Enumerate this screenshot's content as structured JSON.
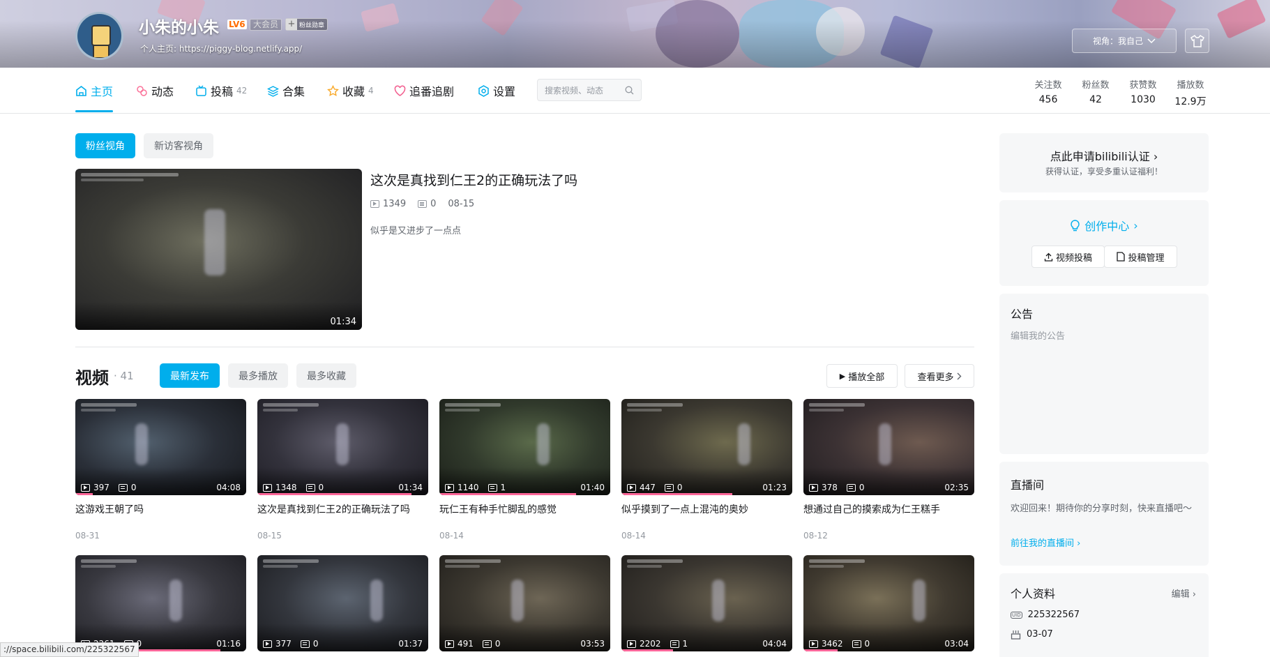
{
  "header": {
    "username": "小朱的小朱",
    "level": "LV6",
    "vip": "大会员",
    "fan_badge": "粉丝勋章",
    "homepage": "个人主页: https://piggy-blog.netlify.app/",
    "view_as": "视角：我自己"
  },
  "nav": {
    "items": [
      {
        "label": "主页",
        "icon": "home-icon",
        "count": ""
      },
      {
        "label": "动态",
        "icon": "dynamic-icon",
        "count": ""
      },
      {
        "label": "投稿",
        "icon": "upload-icon",
        "count": "42"
      },
      {
        "label": "合集",
        "icon": "collection-icon",
        "count": ""
      },
      {
        "label": "收藏",
        "icon": "star-icon",
        "count": "4"
      },
      {
        "label": "追番追剧",
        "icon": "heart-icon",
        "count": ""
      },
      {
        "label": "设置",
        "icon": "settings-icon",
        "count": ""
      }
    ],
    "search_placeholder": "搜索视频、动态"
  },
  "stats": [
    {
      "label": "关注数",
      "value": "456"
    },
    {
      "label": "粉丝数",
      "value": "42"
    },
    {
      "label": "获赞数",
      "value": "1030"
    },
    {
      "label": "播放数",
      "value": "12.9万"
    }
  ],
  "view_tabs": [
    "粉丝视角",
    "新访客视角"
  ],
  "featured": {
    "title": "这次是真找到仁王2的正确玩法了吗",
    "plays": "1349",
    "danmaku": "0",
    "date": "08-15",
    "desc": "似乎是又进步了一点点",
    "duration": "01:34"
  },
  "videos_section": {
    "title": "视频",
    "count": "41",
    "sort_tabs": [
      "最新发布",
      "最多播放",
      "最多收藏"
    ],
    "play_all": "播放全部",
    "view_more": "查看更多"
  },
  "videos": [
    {
      "title": "这游戏王朝了吗",
      "plays": "397",
      "danmaku": "0",
      "duration": "04:08",
      "date": "08-31",
      "progress": 0.1
    },
    {
      "title": "这次是真找到仁王2的正确玩法了吗",
      "plays": "1348",
      "danmaku": "0",
      "duration": "01:34",
      "date": "08-15",
      "progress": 0.9
    },
    {
      "title": "玩仁王有种手忙脚乱的感觉",
      "plays": "1140",
      "danmaku": "1",
      "duration": "01:40",
      "date": "08-14",
      "progress": 0.8
    },
    {
      "title": "似乎摸到了一点上混沌的奥妙",
      "plays": "447",
      "danmaku": "0",
      "duration": "01:23",
      "date": "08-14",
      "progress": 0.65
    },
    {
      "title": "想通过自己的摸索成为仁王糕手",
      "plays": "378",
      "danmaku": "0",
      "duration": "02:35",
      "date": "08-12",
      "progress": 0.0
    },
    {
      "title": "",
      "plays": "2261",
      "danmaku": "0",
      "duration": "01:16",
      "date": "",
      "progress": 0.85
    },
    {
      "title": "",
      "plays": "377",
      "danmaku": "0",
      "duration": "01:37",
      "date": "",
      "progress": 0.0
    },
    {
      "title": "",
      "plays": "491",
      "danmaku": "0",
      "duration": "03:53",
      "date": "",
      "progress": 0.0
    },
    {
      "title": "",
      "plays": "2202",
      "danmaku": "1",
      "duration": "04:04",
      "date": "",
      "progress": 0.3
    },
    {
      "title": "",
      "plays": "3462",
      "danmaku": "0",
      "duration": "03:04",
      "date": "",
      "progress": 0.2
    }
  ],
  "sidebar": {
    "cert_title": "点此申请bilibili认证",
    "cert_sub": "获得认证，享受多重认证福利！",
    "creator_center": "创作中心",
    "upload_btn": "视频投稿",
    "manage_btn": "投稿管理",
    "notice_title": "公告",
    "notice_placeholder": "编辑我的公告",
    "live_title": "直播间",
    "live_desc": "欢迎回来！期待你的分享时刻，快来直播吧～",
    "live_link": "前往我的直播间",
    "profile_title": "个人资料",
    "profile_edit": "编辑",
    "uid": "225322567",
    "birthday": "03-07"
  },
  "status_url": "://space.bilibili.com/225322567",
  "colors": {
    "accent": "#00aeec",
    "pink": "#ff6699",
    "text": "#18191c",
    "muted": "#9499a0"
  }
}
